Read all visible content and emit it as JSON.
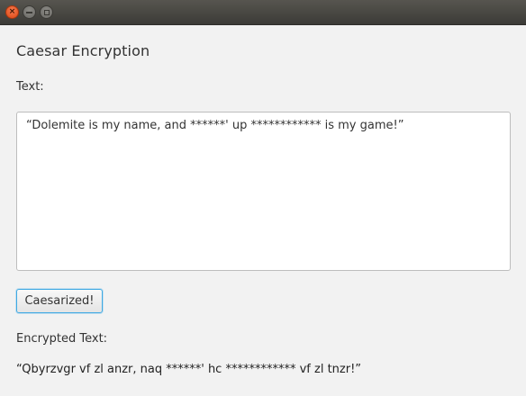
{
  "window": {
    "close_glyph": "×"
  },
  "app": {
    "heading": "Caesar Encryption"
  },
  "input": {
    "label": "Text:",
    "value": "“Dolemite is my name, and ******' up ************ is my game!”"
  },
  "action": {
    "button_label": "Caesarized!"
  },
  "output": {
    "label": "Encrypted Text:",
    "value": "“Qbyrzvgr vf zl anzr, naq ******' hc ************ vf zl tnzr!”"
  },
  "colors": {
    "close_button": "#dd4814",
    "focus_border": "#3fa9e3",
    "titlebar": "#3c3b37"
  }
}
